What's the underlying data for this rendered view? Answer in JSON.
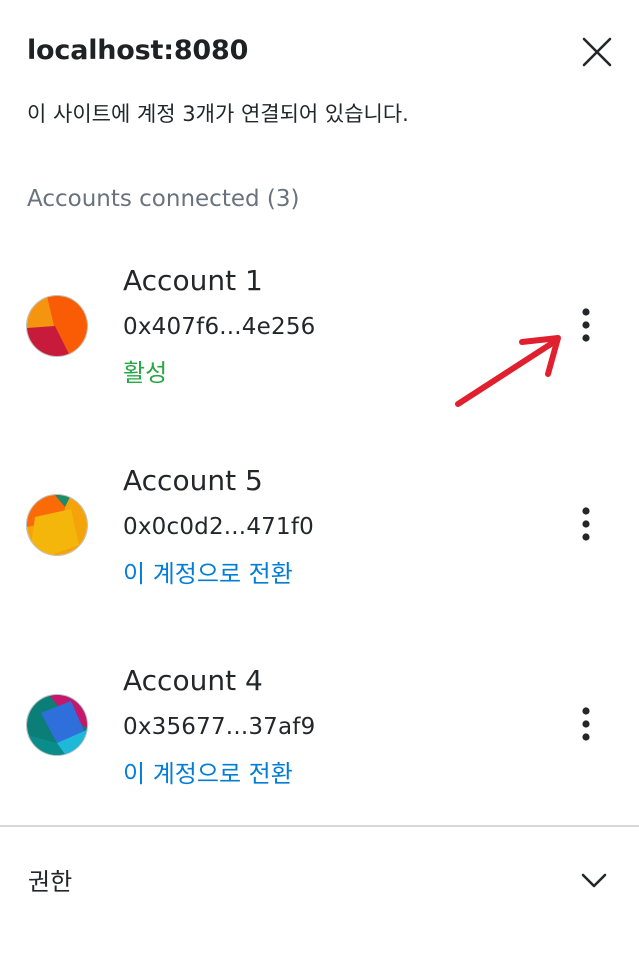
{
  "header": {
    "site": "localhost:8080",
    "close_icon": "close-icon"
  },
  "subtitle": "이 사이트에 계정 3개가 연결되어 있습니다.",
  "section": {
    "label": "Accounts connected (3)"
  },
  "accounts": [
    {
      "name": "Account 1",
      "address": "0x407f6...4e256",
      "status": "활성",
      "status_type": "active",
      "menu_icon": "kebab-menu-icon"
    },
    {
      "name": "Account 5",
      "address": "0x0c0d2...471f0",
      "status": "이 계정으로 전환",
      "status_type": "switch",
      "menu_icon": "kebab-menu-icon"
    },
    {
      "name": "Account 4",
      "address": "0x35677...37af9",
      "status": "이 계정으로 전환",
      "status_type": "switch",
      "menu_icon": "kebab-menu-icon"
    }
  ],
  "permissions": {
    "label": "권한",
    "icon": "chevron-down-icon"
  },
  "colors": {
    "active": "#28a745",
    "link": "#037dd6",
    "annotation_arrow": "#e0202e",
    "muted": "#6a737d"
  }
}
